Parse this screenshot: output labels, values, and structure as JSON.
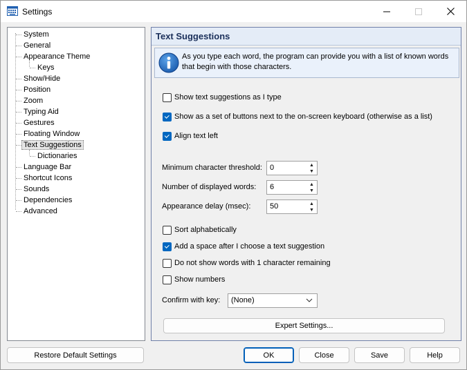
{
  "window": {
    "title": "Settings"
  },
  "tree": {
    "items": [
      {
        "label": "System",
        "level": 0
      },
      {
        "label": "General",
        "level": 0
      },
      {
        "label": "Appearance Theme",
        "level": 0
      },
      {
        "label": "Keys",
        "level": 1
      },
      {
        "label": "Show/Hide",
        "level": 0
      },
      {
        "label": "Position",
        "level": 0
      },
      {
        "label": "Zoom",
        "level": 0
      },
      {
        "label": "Typing Aid",
        "level": 0
      },
      {
        "label": "Gestures",
        "level": 0
      },
      {
        "label": "Floating Window",
        "level": 0
      },
      {
        "label": "Text Suggestions",
        "level": 0,
        "selected": true
      },
      {
        "label": "Dictionaries",
        "level": 1
      },
      {
        "label": "Language Bar",
        "level": 0
      },
      {
        "label": "Shortcut Icons",
        "level": 0
      },
      {
        "label": "Sounds",
        "level": 0
      },
      {
        "label": "Dependencies",
        "level": 0
      },
      {
        "label": "Advanced",
        "level": 0
      }
    ]
  },
  "panel": {
    "title": "Text Suggestions",
    "info_text": "As you type each word, the program can provide you with a list of known words that begin with those characters.",
    "checkboxes": [
      {
        "label": "Show text suggestions as I type",
        "checked": false
      },
      {
        "label": "Show as a set of buttons next to the on-screen keyboard (otherwise as a list)",
        "checked": true
      },
      {
        "label": "Align text left",
        "checked": true
      }
    ],
    "fields": [
      {
        "label": "Minimum character threshold:",
        "value": "0"
      },
      {
        "label": "Number of displayed words:",
        "value": "6"
      },
      {
        "label": "Appearance delay (msec):",
        "value": "50"
      }
    ],
    "checkboxes2": [
      {
        "label": "Sort alphabetically",
        "checked": false
      },
      {
        "label": "Add a space after I choose a text suggestion",
        "checked": true
      },
      {
        "label": "Do not show words with 1 character remaining",
        "checked": false
      },
      {
        "label": "Show numbers",
        "checked": false
      }
    ],
    "confirm": {
      "label": "Confirm with key:",
      "value": "(None)"
    },
    "expert_button": "Expert Settings..."
  },
  "footer": {
    "restore": "Restore Default Settings",
    "ok": "OK",
    "close": "Close",
    "save": "Save",
    "help": "Help"
  },
  "colors": {
    "accent": "#0067c0",
    "header_text": "#1a2f5a"
  },
  "icons": [
    "keyboard-icon",
    "minimize-icon",
    "maximize-icon",
    "close-icon",
    "info-icon",
    "spin-up-icon",
    "spin-down-icon",
    "chevron-down-icon"
  ]
}
